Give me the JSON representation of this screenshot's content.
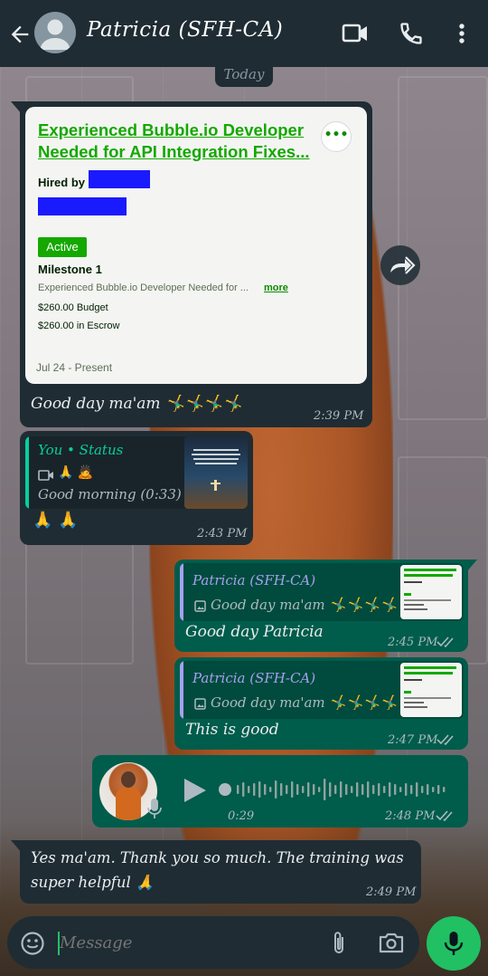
{
  "header": {
    "contact_name": "Patricia (SFH-CA)"
  },
  "date_divider": "Today",
  "messages": {
    "job_card": {
      "title": "Experienced Bubble.io Developer Needed for API Integration Fixes...",
      "hired_by": "Hired by",
      "status_badge": "Active",
      "milestone": "Milestone 1",
      "description": "Experienced Bubble.io Developer Needed for ...",
      "more_link": "more",
      "budget": "$260.00 Budget",
      "escrow": "$260.00 in Escrow",
      "date_range": "Jul 24 - Present",
      "caption": "Good day ma'am 🤸‍♂️🤸‍♂️🤸‍♂️🤸‍♂️",
      "time": "2:39 PM"
    },
    "status_reply": {
      "quote_author": "You • Status",
      "quote_emojis": "🙏 🙇",
      "quote_text": "Good morning (0:33)",
      "text": "🙏 🙏",
      "time": "2:43 PM"
    },
    "reply_1": {
      "quote_author": "Patricia (SFH-CA)",
      "quote_text": "Good day ma'am 🤸‍♂️🤸‍♂️🤸‍♂️🤸‍♂️",
      "text": "Good day Patricia",
      "time": "2:45 PM"
    },
    "reply_2": {
      "quote_author": "Patricia (SFH-CA)",
      "quote_text": "Good day ma'am 🤸‍♂️🤸‍♂️🤸‍♂️🤸‍♂️",
      "text": "This is good",
      "time": "2:47 PM"
    },
    "voice_note": {
      "duration": "0:29",
      "time": "2:48 PM"
    },
    "incoming_last": {
      "text": "Yes ma'am. Thank you so much. The training was super helpful 🙏",
      "time": "2:49 PM"
    }
  },
  "composer": {
    "placeholder": "Message"
  },
  "colors": {
    "header_bg": "#1f2c34",
    "incoming_bubble": "#1f2c34",
    "outgoing_bubble": "#005c4b",
    "quote_author_green": "#06cf9c",
    "quote_author_purple": "#a5a1f0",
    "mic_button": "#21c063",
    "upwork_green": "#14a800"
  }
}
